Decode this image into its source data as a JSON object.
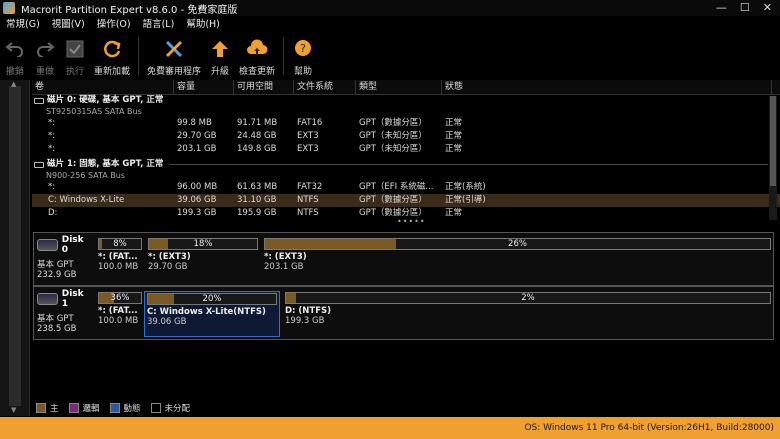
{
  "window": {
    "title": "Macrorit Partition Expert v8.6.0 - 免費家庭版"
  },
  "menu": [
    "常規(G)",
    "視圖(V)",
    "操作(O)",
    "語言(L)",
    "幫助(H)"
  ],
  "toolbar": {
    "undo": "撤銷",
    "redo": "重做",
    "apply": "执行",
    "reload": "重新加載",
    "free_tools": "免費審用程序",
    "upgrade": "升級",
    "check_update": "檢查更新",
    "help": "幫助"
  },
  "table": {
    "headers": [
      "卷",
      "容量",
      "可用空間",
      "文件系統",
      "類型",
      "狀態"
    ],
    "disks": [
      {
        "title": "磁片 0: 硬碟, 基本 GPT, 正常",
        "model": "ST9250315AS SATA Bus",
        "rows": [
          {
            "vol": "*:",
            "cap": "99.8 MB",
            "free": "91.71 MB",
            "fs": "FAT16",
            "type": "GPT（數據分區）",
            "status": "正常"
          },
          {
            "vol": "*:",
            "cap": "29.70 GB",
            "free": "24.48 GB",
            "fs": "EXT3",
            "type": "GPT（未知分區）",
            "status": "正常"
          },
          {
            "vol": "*:",
            "cap": "203.1 GB",
            "free": "149.8 GB",
            "fs": "EXT3",
            "type": "GPT（未知分區）",
            "status": "正常"
          }
        ]
      },
      {
        "title": "磁片 1: 固態, 基本 GPT, 正常",
        "model": "N900-256 SATA Bus",
        "rows": [
          {
            "vol": "*:",
            "cap": "96.00 MB",
            "free": "61.63 MB",
            "fs": "FAT32",
            "type": "GPT（EFI 系統磁...",
            "status": "正常(系統)"
          },
          {
            "vol": "C: Windows X-Lite",
            "cap": "39.06 GB",
            "free": "31.10 GB",
            "fs": "NTFS",
            "type": "GPT（數據分區）",
            "status": "正常(引導)"
          },
          {
            "vol": "D:",
            "cap": "199.3 GB",
            "free": "195.9 GB",
            "fs": "NTFS",
            "type": "GPT（數據分區）",
            "status": "正常"
          }
        ]
      }
    ],
    "more": "•••••"
  },
  "map": [
    {
      "name": "Disk 0",
      "type": "基本 GPT",
      "size": "232.9 GB",
      "parts": [
        {
          "pct": "8%",
          "used": 0.08,
          "label": "*: (FAT...",
          "size": "100.0 MB"
        },
        {
          "pct": "18%",
          "used": 0.18,
          "label": "*: (EXT3)",
          "size": "29.70 GB"
        },
        {
          "pct": "26%",
          "used": 0.26,
          "label": "*: (EXT3)",
          "size": "203.1 GB"
        }
      ]
    },
    {
      "name": "Disk 1",
      "type": "基本 GPT",
      "size": "238.5 GB",
      "parts": [
        {
          "pct": "36%",
          "used": 0.36,
          "label": "*: (FAT...",
          "size": "100.0 MB"
        },
        {
          "pct": "20%",
          "used": 0.2,
          "label": "C: Windows X-Lite(NTFS)",
          "size": "39.06 GB"
        },
        {
          "pct": "2%",
          "used": 0.02,
          "label": "D: (NTFS)",
          "size": "199.3 GB"
        }
      ]
    }
  ],
  "legend": [
    {
      "label": "主",
      "color": "#7a5a22"
    },
    {
      "label": "邏輯",
      "color": "#7a2a7a"
    },
    {
      "label": "動態",
      "color": "#2a5aa0"
    },
    {
      "label": "未分配",
      "color": "#000000"
    }
  ],
  "status": "OS: Windows 11 Pro 64-bit (Version:26H1, Build:28000)",
  "colors": {
    "accent": "#f0a030",
    "selection": "#3a2a18"
  }
}
